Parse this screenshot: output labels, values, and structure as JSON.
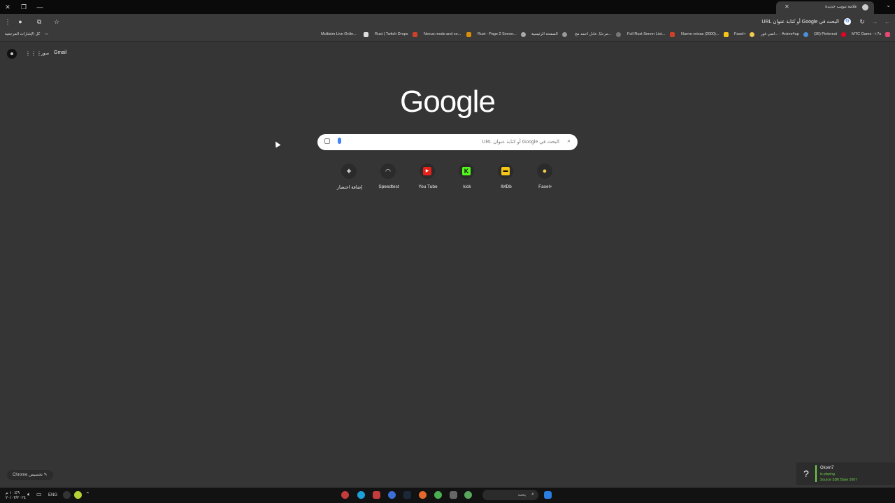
{
  "tab": {
    "title": "علامة تبويب جديدة"
  },
  "omnibox": {
    "text": "البحث في Google أو كتابة عنوان URL"
  },
  "bookmarks": {
    "all_bookmarks": "كل الإشارات المرجعية",
    "items": [
      {
        "label": "MTC Game - i-7s",
        "color": "#e34a6f"
      },
      {
        "label": "(36) Pinterest",
        "color": "#e60023"
      },
      {
        "label": "انمي فور... - Anime4up",
        "color": "#4a90d9"
      },
      {
        "label": "Fasel+",
        "color": "#f2c94c"
      },
      {
        "label": "Nueve reinas (2000)...",
        "color": "#f5c518"
      },
      {
        "label": "Full Rust Server List...",
        "color": "#cd412b"
      },
      {
        "label": "مرحبًا, عادل احمد مح...",
        "color": "#777777"
      },
      {
        "label": "الصفحة الرئيسية",
        "color": "#999999"
      },
      {
        "label": "Rust - Page 2 Server...",
        "color": "#aaaaaa"
      },
      {
        "label": "Nexus mods and co...",
        "color": "#d98e04"
      },
      {
        "label": "Rust | Twitch Drops",
        "color": "#cd412b"
      },
      {
        "label": "Multisim Live Onlin...",
        "color": "#dddddd"
      }
    ]
  },
  "header": {
    "gmail": "Gmail",
    "images": "صور"
  },
  "logo": "Google",
  "search": {
    "placeholder": "البحث في Google أو كتابة عنوان URL"
  },
  "shortcuts": [
    {
      "label": "إضافة اختصار",
      "icon": "plus-icon",
      "glyph": "+",
      "color": "#eeeeee",
      "bg": "transparent"
    },
    {
      "label": "Speedtest",
      "icon": "speedtest-icon",
      "glyph": "◠",
      "color": "#ffffff",
      "bg": "transparent"
    },
    {
      "label": "You Tube",
      "icon": "youtube-icon",
      "glyph": "▶",
      "color": "#ffffff",
      "bg": "#e62117"
    },
    {
      "label": "kick",
      "icon": "kick-icon",
      "glyph": "K",
      "color": "#111111",
      "bg": "#53fc18"
    },
    {
      "label": "IMDb",
      "icon": "imdb-icon",
      "glyph": "▬",
      "color": "#111111",
      "bg": "#f5c518"
    },
    {
      "label": "Fasel+",
      "icon": "fasel-icon",
      "glyph": "●",
      "color": "#f2c94c",
      "bg": "transparent"
    }
  ],
  "customize": {
    "label": "تخصيص Chrome"
  },
  "overlay": {
    "name": "Okom7",
    "status": "is playing",
    "game": "Source SDK Base 2007"
  },
  "taskbar": {
    "search": "بحث",
    "lang": "ENG",
    "time": "١٠:٤٩ م",
    "date": "٢٠/٠٣/٢٠٢٤"
  }
}
